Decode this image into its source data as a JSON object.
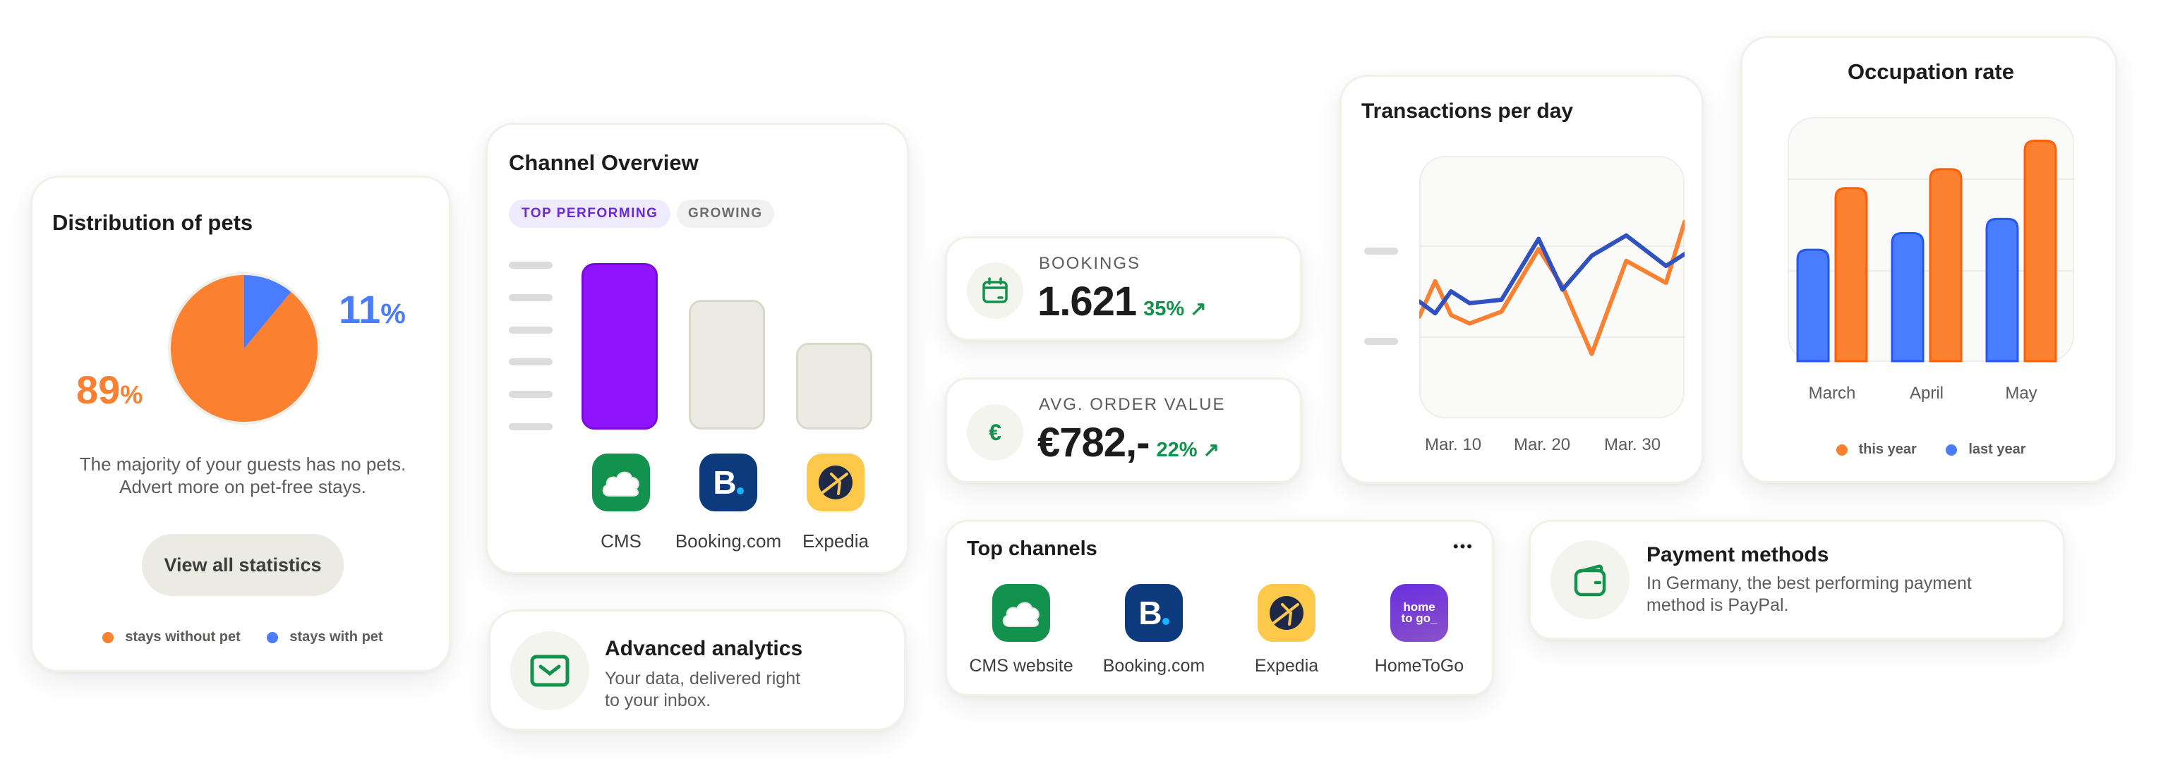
{
  "colors": {
    "orange": "#fb8030",
    "blue": "#4a7cff",
    "navy_line": "#2f52c0",
    "green": "#12924c",
    "purple": "#9013fe",
    "booking_blue": "#0c3a7c",
    "expedia_yellow": "#fec84b",
    "hometogo_purple": "#6a3bd8"
  },
  "pets": {
    "title": "Distribution of pets",
    "big_without": "89",
    "big_with": "11",
    "pct": "%",
    "desc_line1": "The majority of your guests has no pets.",
    "desc_line2": "Advert more on pet-free stays.",
    "button": "View all statistics",
    "legend": [
      "stays without pet",
      "stays with pet"
    ]
  },
  "channel_overview": {
    "title": "Channel Overview",
    "tabs": [
      "TOP PERFORMING",
      "GROWING"
    ],
    "channels": [
      {
        "name": "CMS",
        "icon": "cloud-icon"
      },
      {
        "name": "Booking.com",
        "icon": "booking-logo-icon"
      },
      {
        "name": "Expedia",
        "icon": "expedia-logo-icon"
      }
    ]
  },
  "advanced": {
    "title": "Advanced analytics",
    "line1": "Your data, delivered right",
    "line2": "to your inbox."
  },
  "bookings": {
    "label": "BOOKINGS",
    "value": "1.621",
    "change": "35%",
    "arrow": "↗"
  },
  "order_value": {
    "label": "AVG. ORDER VALUE",
    "value": "€782,-",
    "change": "22%",
    "arrow": "↗",
    "icon": "€"
  },
  "top_channels": {
    "title": "Top channels",
    "more": "•••",
    "items": [
      {
        "name": "CMS website"
      },
      {
        "name": "Booking.com"
      },
      {
        "name": "Expedia"
      },
      {
        "name": "HomeToGo",
        "logo_line1": "home",
        "logo_line2": "to go_"
      }
    ]
  },
  "payment": {
    "title": "Payment methods",
    "line1": "In Germany, the best performing payment",
    "line2": "method is PayPal."
  },
  "chart_data": [
    {
      "type": "pie",
      "title": "Distribution of pets",
      "categories": [
        "stays without pet",
        "stays with pet"
      ],
      "values": [
        89,
        11
      ],
      "legend": "bottom"
    },
    {
      "type": "bar",
      "title": "Channel Overview",
      "categories": [
        "CMS",
        "Booking.com",
        "Expedia"
      ],
      "values": [
        100,
        78,
        52
      ],
      "highlight": "CMS"
    },
    {
      "type": "line",
      "title": "Transactions per day",
      "x_tick_labels": [
        "Mar. 10",
        "Mar. 20",
        "Mar. 30"
      ],
      "ylim": [
        0,
        100
      ],
      "series": [
        {
          "name": "orange",
          "values": [
            30,
            51,
            31,
            26,
            33,
            70,
            48,
            8,
            63,
            50,
            86
          ]
        },
        {
          "name": "blue",
          "values": [
            39,
            32,
            45,
            38,
            40,
            76,
            46,
            66,
            78,
            60,
            67
          ]
        }
      ],
      "x": [
        0,
        0.06,
        0.12,
        0.19,
        0.31,
        0.45,
        0.54,
        0.65,
        0.78,
        0.93,
        1.0
      ]
    },
    {
      "type": "bar",
      "title": "Occupation rate",
      "categories": [
        "March",
        "April",
        "May"
      ],
      "series": [
        {
          "name": "last year",
          "values": [
            47,
            54,
            60
          ]
        },
        {
          "name": "this year",
          "values": [
            73,
            81,
            93
          ]
        }
      ],
      "ylim": [
        0,
        100
      ],
      "legend": "bottom"
    }
  ]
}
